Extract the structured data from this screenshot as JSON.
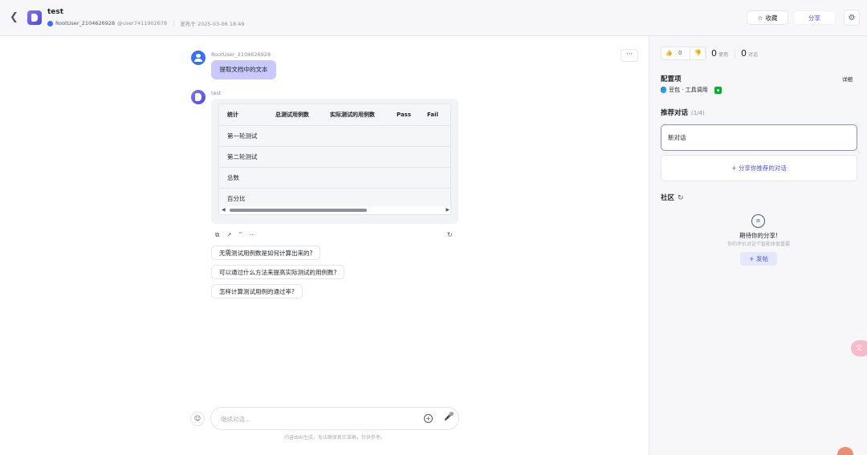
{
  "header": {
    "back_icon": "chevron-left-icon",
    "title": "test",
    "author": "RootUser_2104626928",
    "handle": "@user7411902678",
    "published": "发布于 2025-03-06 18:49",
    "favorite_label": "收藏",
    "share_label": "分享",
    "settings_icon": "gear-icon"
  },
  "chat": {
    "more_label": "···",
    "user": {
      "name": "RootUser_2104626928",
      "message": "提取文档中的文本"
    },
    "bot": {
      "name": "test",
      "table": {
        "headers": [
          "统计",
          "总测试用例数",
          "实际测试的用例数",
          "Pass",
          "Fail"
        ],
        "rows": [
          [
            "第一轮测试",
            "",
            "",
            "",
            ""
          ],
          [
            "第二轮测试",
            "",
            "",
            "",
            ""
          ],
          [
            "总数",
            "",
            "",
            "",
            ""
          ],
          [
            "百分比",
            "",
            "",
            "",
            ""
          ]
        ]
      },
      "actions": [
        "copy-icon",
        "share-icon",
        "quote-icon",
        "more-icon"
      ]
    },
    "suggestions": [
      "无需测试用例数是如何计算出来的?",
      "可以通过什么方法来提高实际测试的用例数?",
      "怎样计算测试用例的通过率?"
    ],
    "input_placeholder": "继续对话...",
    "disclaimer": "内容由AI生成，无法确保真实准确，仅供参考。"
  },
  "sidebar": {
    "likes": "0",
    "uses_count": "0",
    "uses_label": "使用",
    "conversations_count": "0",
    "conversations_label": "对话",
    "config_title": "配置项",
    "detail_label": "详细",
    "model_label": "豆包 · 工具调用",
    "recommend_title": "推荐对话",
    "recommend_count": "(1/4)",
    "recommend_item": "新对话",
    "share_recommend": "+ 分享你推荐的对话",
    "community_title": "社区",
    "community_empty_title": "期待你的分享!",
    "community_empty_sub": "你的评价对这个智能体很重要",
    "post_label": "+ 发帖"
  },
  "colors": {
    "accent": "#4d53e8",
    "user_bubble": "#c9c9ff",
    "avatar_blue": "#3370ff"
  }
}
